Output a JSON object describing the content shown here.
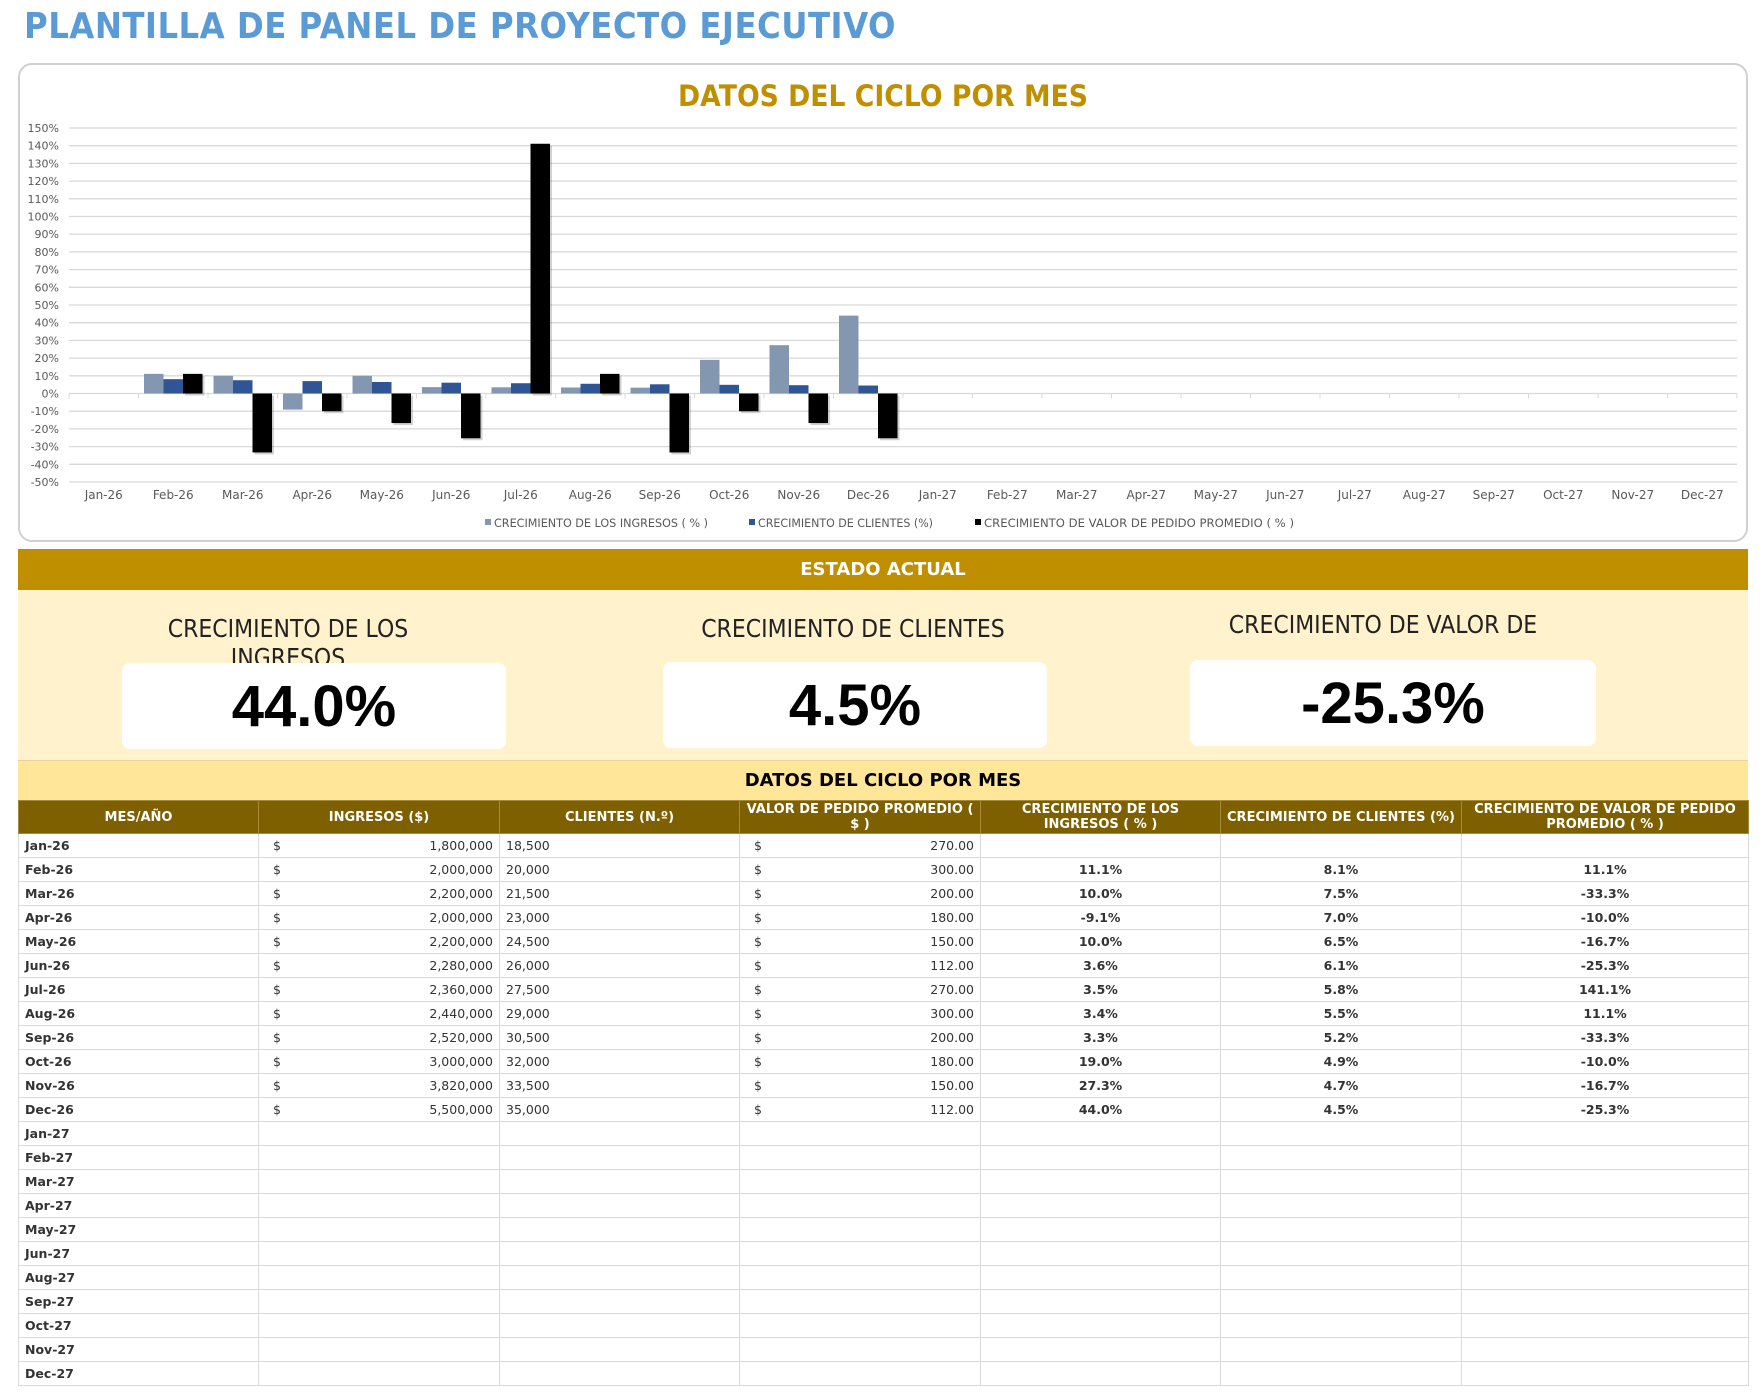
{
  "page": {
    "title": "PLANTILLA DE PANEL DE PROYECTO EJECUTIVO"
  },
  "colors": {
    "title_blue": "#5b9bd5",
    "gold": "#bf8f00",
    "cream": "#fff2cc",
    "light_yellow": "#ffe699",
    "brown": "#7f6000",
    "series_revenue": "#8497b0",
    "series_clients": "#2f5597",
    "series_order": "#000000"
  },
  "chart_data": {
    "type": "bar",
    "title": "DATOS DEL CICLO POR MES",
    "xlabel": "",
    "ylabel": "",
    "ylim": [
      -0.5,
      1.5
    ],
    "ytick_step": 0.1,
    "ytick_labels": [
      "150%",
      "140%",
      "130%",
      "120%",
      "110%",
      "100%",
      "90%",
      "80%",
      "70%",
      "60%",
      "50%",
      "40%",
      "30%",
      "20%",
      "10%",
      "0%",
      "-10%",
      "-20%",
      "-30%",
      "-40%",
      "-50%"
    ],
    "grid": true,
    "legend_position": "bottom",
    "categories": [
      "Jan-26",
      "Feb-26",
      "Mar-26",
      "Apr-26",
      "May-26",
      "Jun-26",
      "Jul-26",
      "Aug-26",
      "Sep-26",
      "Oct-26",
      "Nov-26",
      "Dec-26",
      "Jan-27",
      "Feb-27",
      "Mar-27",
      "Apr-27",
      "May-27",
      "Jun-27",
      "Jul-27",
      "Aug-27",
      "Sep-27",
      "Oct-27",
      "Nov-27",
      "Dec-27"
    ],
    "series": [
      {
        "name": "CRECIMIENTO DE LOS INGRESOS ( % )",
        "color": "#8497b0",
        "values": [
          null,
          0.111,
          0.1,
          -0.091,
          0.1,
          0.036,
          0.035,
          0.034,
          0.033,
          0.19,
          0.273,
          0.44,
          null,
          null,
          null,
          null,
          null,
          null,
          null,
          null,
          null,
          null,
          null,
          null
        ]
      },
      {
        "name": "CRECIMIENTO DE CLIENTES (%)",
        "color": "#2f5597",
        "values": [
          null,
          0.081,
          0.075,
          0.07,
          0.065,
          0.061,
          0.058,
          0.055,
          0.052,
          0.049,
          0.047,
          0.045,
          null,
          null,
          null,
          null,
          null,
          null,
          null,
          null,
          null,
          null,
          null,
          null
        ]
      },
      {
        "name": "CRECIMIENTO DE VALOR DE PEDIDO PROMEDIO ( % )",
        "color": "#000000",
        "values": [
          null,
          0.111,
          -0.333,
          -0.1,
          -0.167,
          -0.253,
          1.411,
          0.111,
          -0.333,
          -0.1,
          -0.167,
          -0.253,
          null,
          null,
          null,
          null,
          null,
          null,
          null,
          null,
          null,
          null,
          null,
          null
        ]
      }
    ]
  },
  "status": {
    "header": "ESTADO ACTUAL",
    "kpis": [
      {
        "label": "CRECIMIENTO DE LOS INGRESOS",
        "value": "44.0%"
      },
      {
        "label": "CRECIMIENTO DE CLIENTES",
        "value": "4.5%"
      },
      {
        "label": "CRECIMIENTO DE VALOR DE",
        "value": "-25.3%"
      }
    ]
  },
  "table": {
    "title": "DATOS DEL CICLO POR MES",
    "currency_symbol": "$",
    "headers": [
      "MES/AÑO",
      "INGRESOS ($)",
      "CLIENTES (N.º)",
      "VALOR DE PEDIDO PROMEDIO ( $ )",
      "CRECIMIENTO DE LOS INGRESOS ( % )",
      "CRECIMIENTO DE CLIENTES (%)",
      "CRECIMIENTO DE VALOR DE PEDIDO PROMEDIO ( % )"
    ],
    "rows": [
      {
        "month": "Jan-26",
        "revenue": "1,800,000",
        "clients": "18,500",
        "avg_order": "270.00",
        "rev_growth": "",
        "client_growth": "",
        "order_growth": ""
      },
      {
        "month": "Feb-26",
        "revenue": "2,000,000",
        "clients": "20,000",
        "avg_order": "300.00",
        "rev_growth": "11.1%",
        "client_growth": "8.1%",
        "order_growth": "11.1%"
      },
      {
        "month": "Mar-26",
        "revenue": "2,200,000",
        "clients": "21,500",
        "avg_order": "200.00",
        "rev_growth": "10.0%",
        "client_growth": "7.5%",
        "order_growth": "-33.3%"
      },
      {
        "month": "Apr-26",
        "revenue": "2,000,000",
        "clients": "23,000",
        "avg_order": "180.00",
        "rev_growth": "-9.1%",
        "client_growth": "7.0%",
        "order_growth": "-10.0%"
      },
      {
        "month": "May-26",
        "revenue": "2,200,000",
        "clients": "24,500",
        "avg_order": "150.00",
        "rev_growth": "10.0%",
        "client_growth": "6.5%",
        "order_growth": "-16.7%"
      },
      {
        "month": "Jun-26",
        "revenue": "2,280,000",
        "clients": "26,000",
        "avg_order": "112.00",
        "rev_growth": "3.6%",
        "client_growth": "6.1%",
        "order_growth": "-25.3%"
      },
      {
        "month": "Jul-26",
        "revenue": "2,360,000",
        "clients": "27,500",
        "avg_order": "270.00",
        "rev_growth": "3.5%",
        "client_growth": "5.8%",
        "order_growth": "141.1%"
      },
      {
        "month": "Aug-26",
        "revenue": "2,440,000",
        "clients": "29,000",
        "avg_order": "300.00",
        "rev_growth": "3.4%",
        "client_growth": "5.5%",
        "order_growth": "11.1%"
      },
      {
        "month": "Sep-26",
        "revenue": "2,520,000",
        "clients": "30,500",
        "avg_order": "200.00",
        "rev_growth": "3.3%",
        "client_growth": "5.2%",
        "order_growth": "-33.3%"
      },
      {
        "month": "Oct-26",
        "revenue": "3,000,000",
        "clients": "32,000",
        "avg_order": "180.00",
        "rev_growth": "19.0%",
        "client_growth": "4.9%",
        "order_growth": "-10.0%"
      },
      {
        "month": "Nov-26",
        "revenue": "3,820,000",
        "clients": "33,500",
        "avg_order": "150.00",
        "rev_growth": "27.3%",
        "client_growth": "4.7%",
        "order_growth": "-16.7%"
      },
      {
        "month": "Dec-26",
        "revenue": "5,500,000",
        "clients": "35,000",
        "avg_order": "112.00",
        "rev_growth": "44.0%",
        "client_growth": "4.5%",
        "order_growth": "-25.3%"
      },
      {
        "month": "Jan-27",
        "revenue": "",
        "clients": "",
        "avg_order": "",
        "rev_growth": "",
        "client_growth": "",
        "order_growth": ""
      },
      {
        "month": "Feb-27",
        "revenue": "",
        "clients": "",
        "avg_order": "",
        "rev_growth": "",
        "client_growth": "",
        "order_growth": ""
      },
      {
        "month": "Mar-27",
        "revenue": "",
        "clients": "",
        "avg_order": "",
        "rev_growth": "",
        "client_growth": "",
        "order_growth": ""
      },
      {
        "month": "Apr-27",
        "revenue": "",
        "clients": "",
        "avg_order": "",
        "rev_growth": "",
        "client_growth": "",
        "order_growth": ""
      },
      {
        "month": "May-27",
        "revenue": "",
        "clients": "",
        "avg_order": "",
        "rev_growth": "",
        "client_growth": "",
        "order_growth": ""
      },
      {
        "month": "Jun-27",
        "revenue": "",
        "clients": "",
        "avg_order": "",
        "rev_growth": "",
        "client_growth": "",
        "order_growth": ""
      },
      {
        "month": "Aug-27",
        "revenue": "",
        "clients": "",
        "avg_order": "",
        "rev_growth": "",
        "client_growth": "",
        "order_growth": ""
      },
      {
        "month": "Sep-27",
        "revenue": "",
        "clients": "",
        "avg_order": "",
        "rev_growth": "",
        "client_growth": "",
        "order_growth": ""
      },
      {
        "month": "Oct-27",
        "revenue": "",
        "clients": "",
        "avg_order": "",
        "rev_growth": "",
        "client_growth": "",
        "order_growth": ""
      },
      {
        "month": "Nov-27",
        "revenue": "",
        "clients": "",
        "avg_order": "",
        "rev_growth": "",
        "client_growth": "",
        "order_growth": ""
      },
      {
        "month": "Dec-27",
        "revenue": "",
        "clients": "",
        "avg_order": "",
        "rev_growth": "",
        "client_growth": "",
        "order_growth": ""
      }
    ]
  }
}
